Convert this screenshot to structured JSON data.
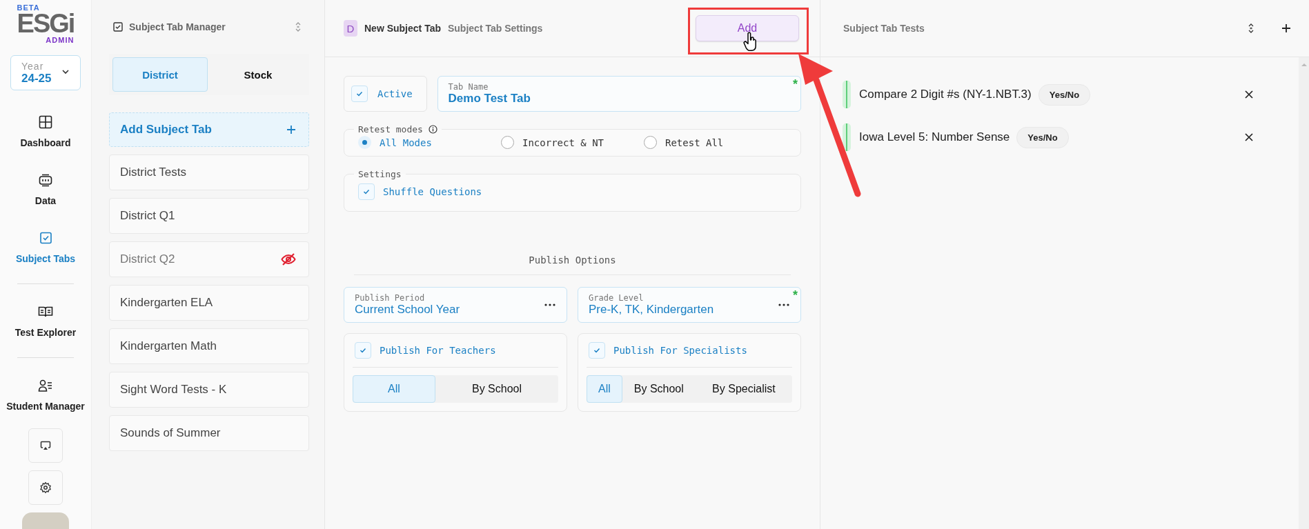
{
  "logo": {
    "badge": "BETA",
    "name": "ESGi",
    "subtitle": "ADMIN"
  },
  "year_selector": {
    "label": "Year",
    "value": "24-25"
  },
  "nav": [
    {
      "label": "Dashboard",
      "selected": false
    },
    {
      "label": "Data",
      "selected": false
    },
    {
      "label": "Subject Tabs",
      "selected": true
    },
    {
      "label": "Test Explorer",
      "selected": false
    },
    {
      "label": "Student Manager",
      "selected": false
    }
  ],
  "manager": {
    "title": "Subject Tab Manager",
    "tabs": [
      {
        "label": "District",
        "selected": true
      },
      {
        "label": "Stock",
        "selected": false
      }
    ],
    "add_button": "Add Subject Tab",
    "items": [
      {
        "label": "District Tests",
        "hidden": false
      },
      {
        "label": "District Q1",
        "hidden": false
      },
      {
        "label": "District Q2",
        "hidden": true
      },
      {
        "label": "Kindergarten ELA",
        "hidden": false
      },
      {
        "label": "Kindergarten Math",
        "hidden": false
      },
      {
        "label": "Sight Word Tests - K",
        "hidden": false
      },
      {
        "label": "Sounds of Summer",
        "hidden": false
      }
    ]
  },
  "settings": {
    "badge": "D",
    "title": "New Subject Tab",
    "subtitle": "Subject Tab Settings",
    "add_button": "Add",
    "active": {
      "label": "Active",
      "checked": true
    },
    "tab_name": {
      "label": "Tab Name",
      "value": "Demo Test Tab",
      "required_mark": "*"
    },
    "retest_modes": {
      "label": "Retest modes",
      "options": [
        {
          "label": "All Modes",
          "selected": true
        },
        {
          "label": "Incorrect & NT",
          "selected": false
        },
        {
          "label": "Retest All",
          "selected": false
        }
      ]
    },
    "options": {
      "label": "Settings",
      "items": [
        {
          "label": "Shuffle Questions",
          "checked": true
        }
      ]
    },
    "publish": {
      "title": "Publish Options",
      "fields": [
        {
          "label": "Publish Period",
          "value": "Current School Year"
        },
        {
          "label": "Grade Level",
          "value": "Pre-K, TK, Kindergarten",
          "required_mark": "*"
        }
      ],
      "groups": [
        {
          "label": "Publish For Teachers",
          "checked": true,
          "options": [
            {
              "label": "All",
              "selected": true
            },
            {
              "label": "By School",
              "selected": false
            }
          ]
        },
        {
          "label": "Publish For Specialists",
          "checked": true,
          "options": [
            {
              "label": "All",
              "selected": true
            },
            {
              "label": "By School",
              "selected": false
            },
            {
              "label": "By Specialist",
              "selected": false
            }
          ]
        }
      ]
    }
  },
  "tests": {
    "title": "Subject Tab Tests",
    "items": [
      {
        "name": "Compare 2 Digit #s (NY-1.NBT.3)",
        "type": "Yes/No"
      },
      {
        "name": "Iowa Level 5: Number Sense",
        "type": "Yes/No"
      }
    ]
  }
}
